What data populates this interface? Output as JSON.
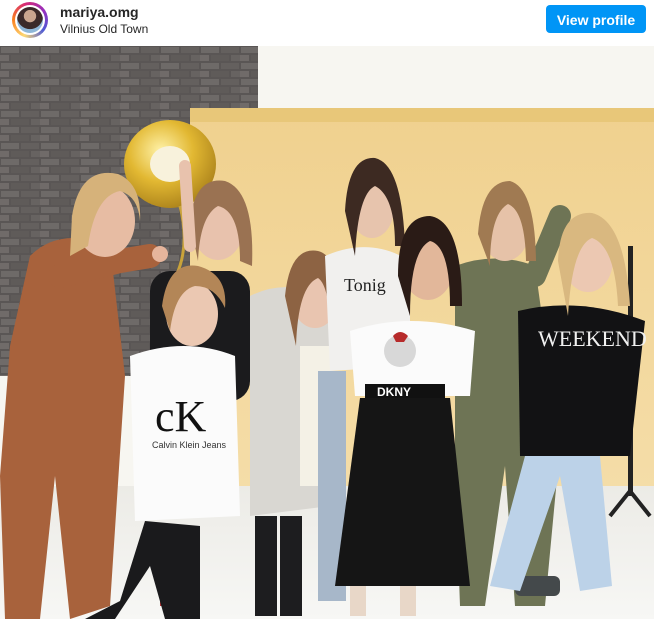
{
  "header": {
    "username": "mariya.omg",
    "location": "Vilnius Old Town",
    "view_profile_label": "View profile"
  },
  "photo": {
    "shirt_texts": {
      "tonight": "Tonig",
      "calvin_klein_logo": "cK",
      "calvin_klein_text": "Calvin Klein Jeans",
      "dkny": "DKNY",
      "weekend": "WEEKEND"
    }
  },
  "colors": {
    "accent": "#0095f6",
    "text": "#262626"
  }
}
